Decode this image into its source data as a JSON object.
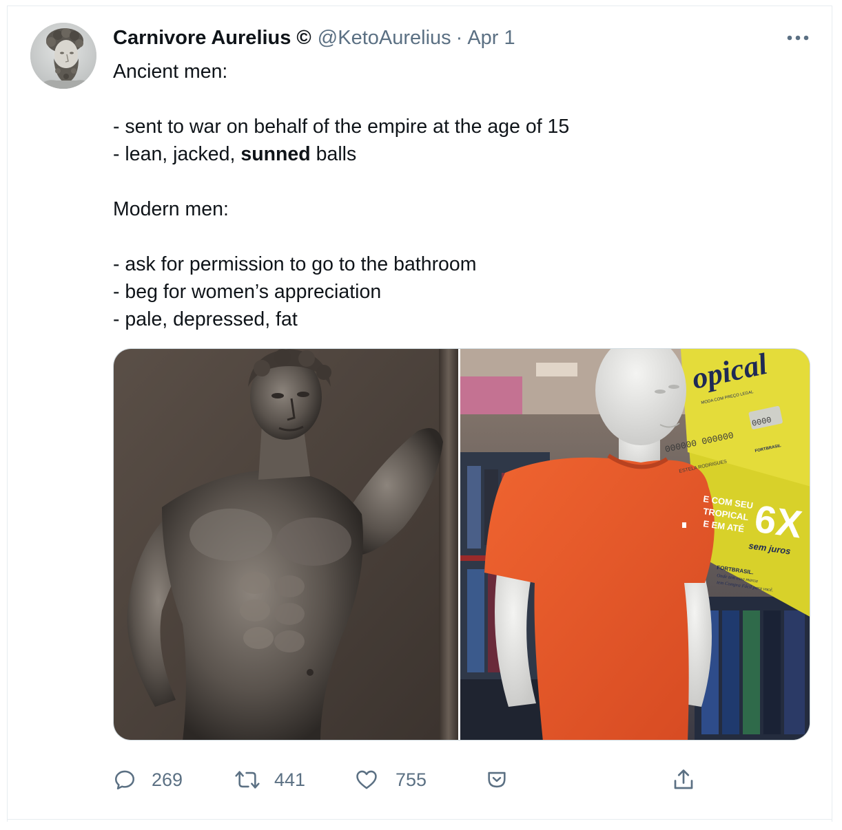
{
  "tweet": {
    "author": {
      "display_name": "Carnivore Aurelius",
      "parody_mark": "©",
      "handle": "@KetoAurelius",
      "separator": "·",
      "date": "Apr 1"
    },
    "text_lines": [
      "Ancient men:",
      "",
      "- sent to war on behalf of the empire at the age of 15",
      "",
      "",
      "Modern men:",
      "",
      "- ask for permission to go to the bathroom",
      "- beg for women’s appreciation",
      "- pale, depressed, fat"
    ],
    "rich_line": {
      "before": "- lean, jacked, ",
      "bold": "sunned",
      "after": " balls"
    },
    "media": {
      "sign_brand": "opical",
      "sign_tagline": "MODA COM PREÇO LEGAL",
      "card_digits_1": "000000 000000",
      "card_digits_2": "0000",
      "card_name": "ESTELA RODRIGUES",
      "card_logo": "FORTBRASIL",
      "promo_line_1": "E COM SEU",
      "promo_line_2": "TROPICAL",
      "promo_line_3": "E EM ATÉ",
      "promo_big": "6X",
      "promo_sub": "sem juros",
      "footer_brand": "FORTBRASIL.",
      "footer_line_1": "Onde tem essa marca",
      "footer_line_2": "tem Compra Fácil para você."
    },
    "actions": {
      "reply_count": "269",
      "retweet_count": "441",
      "like_count": "755"
    }
  },
  "colors": {
    "text_primary": "#0f1419",
    "text_secondary": "#5b7083",
    "border": "#e6ecf0",
    "shirt_orange": "#e8562a",
    "sign_yellow": "#d8d12a"
  },
  "icons": {
    "reply": "speech-bubble-icon",
    "retweet": "retweet-arrows-icon",
    "like": "heart-icon",
    "save": "pocket-icon",
    "share": "share-upload-icon",
    "more": "ellipsis-icon"
  }
}
